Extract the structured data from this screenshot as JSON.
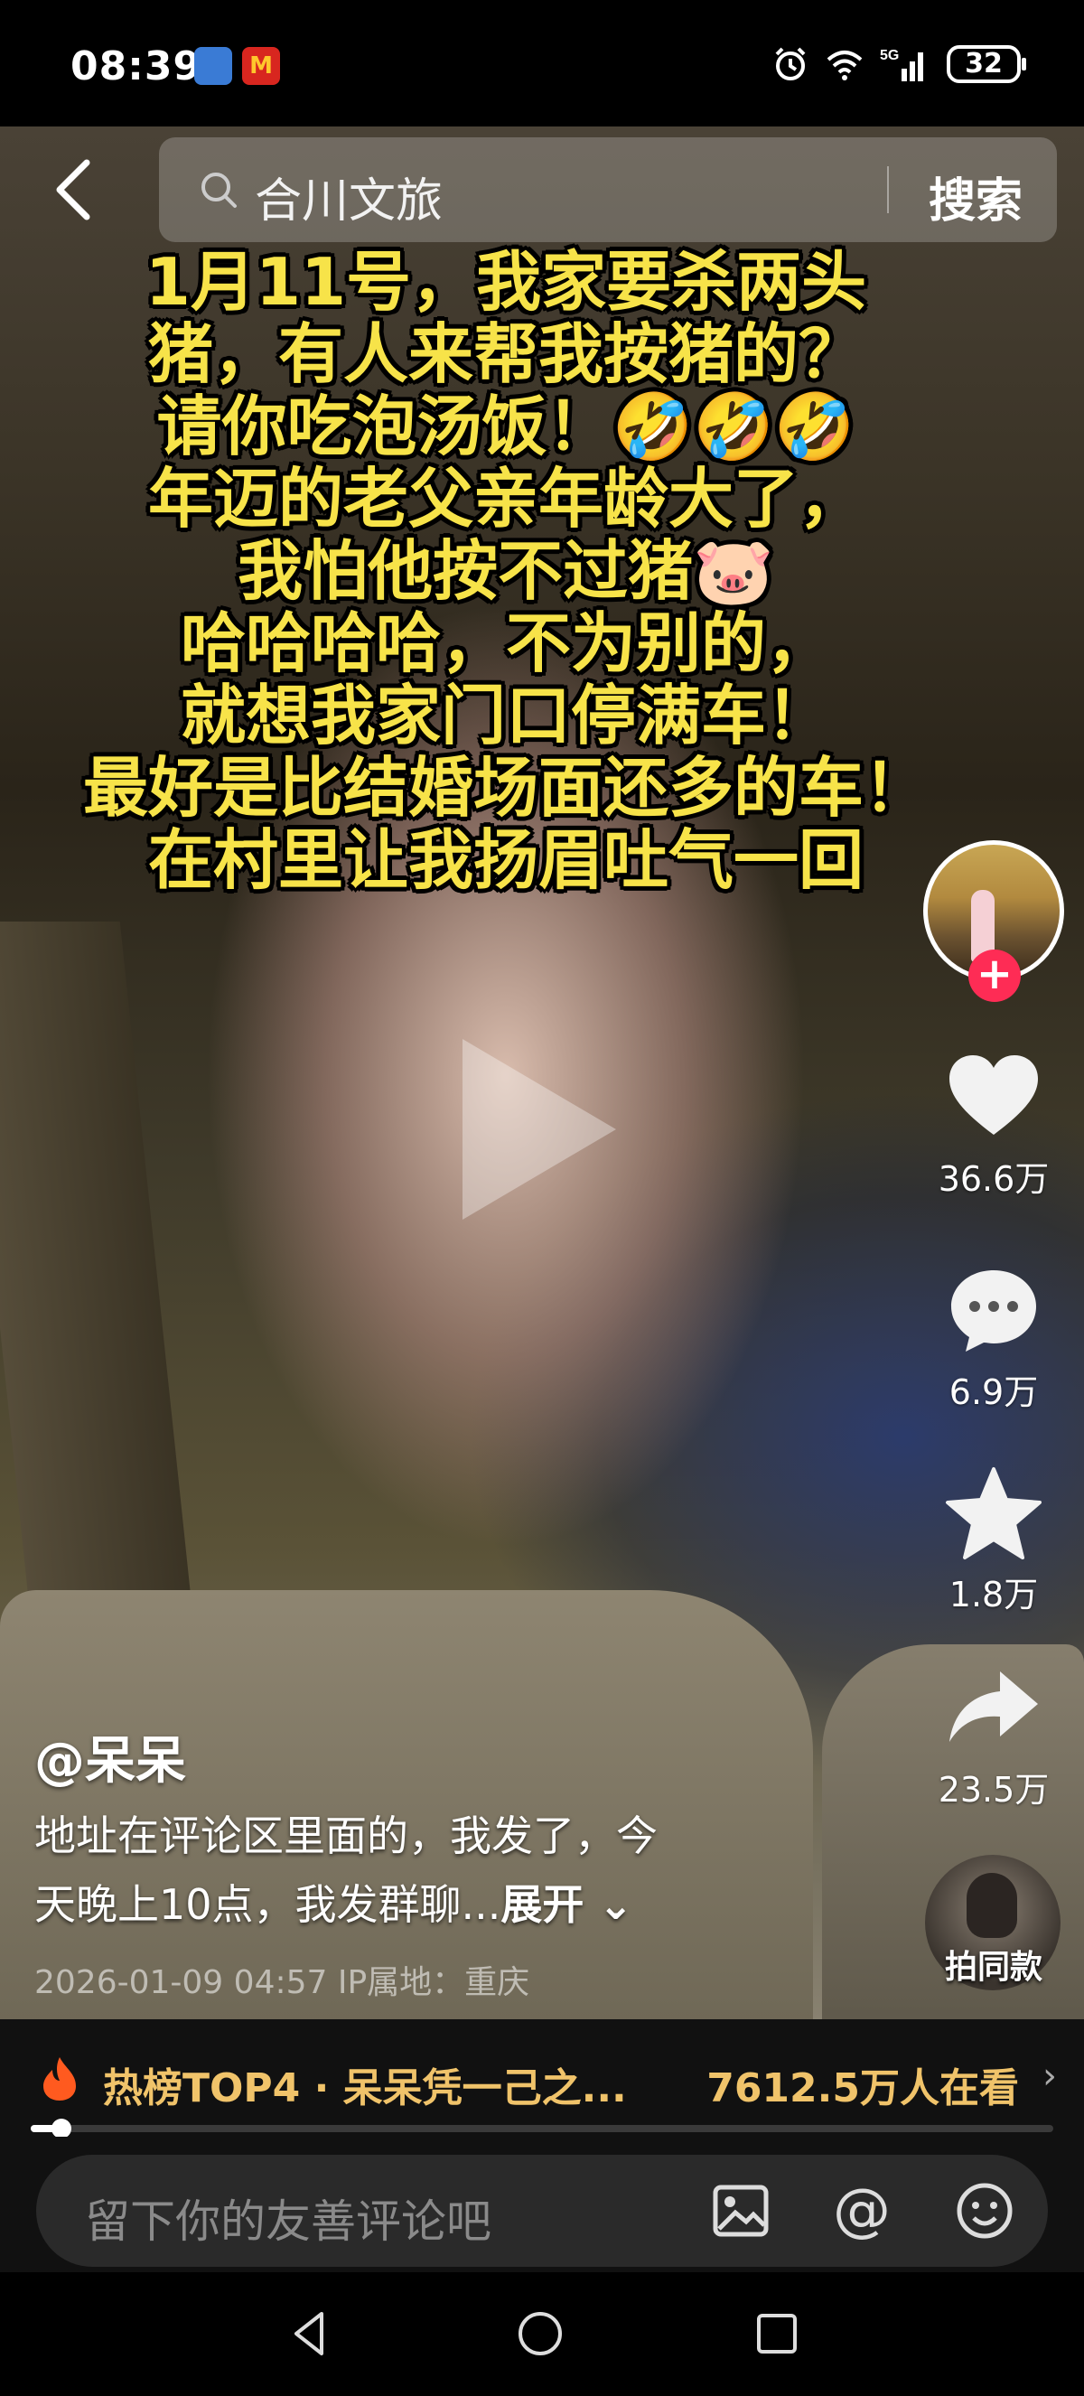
{
  "status_bar": {
    "time": "08:39",
    "network": "5G",
    "battery": "32",
    "badges": [
      "App Market",
      "M"
    ]
  },
  "search": {
    "query": "合川文旅",
    "button_label": "搜索"
  },
  "caption_lines": [
    "1月11号，我家要杀两头",
    "猪，有人来帮我按猪的？",
    "请你吃泡汤饭！🤣🤣🤣",
    "年迈的老父亲年龄大了，",
    "我怕他按不过猪🐷",
    "哈哈哈哈，不为别的，",
    "就想我家门口停满车！",
    "最好是比结婚场面还多的车！",
    "在村里让我扬眉吐气一回"
  ],
  "actions": {
    "likes": "36.6万",
    "comments": "6.9万",
    "favorites": "1.8万",
    "shares": "23.5万"
  },
  "same_style_label": "拍同款",
  "post": {
    "author": "@呆呆",
    "description_line1": "地址在评论区里面的，我发了，今",
    "description_line2": "天晚上10点，我发群聊...",
    "expand_label": "展开",
    "meta": "2026-01-09 04:57  IP属地：重庆"
  },
  "hot": {
    "title": "热榜TOP4 · 呆呆凭一己之...",
    "viewers": "7612.5万人在看"
  },
  "progress": {
    "fraction": 0.03
  },
  "comment": {
    "placeholder": "留下你的友善评论吧",
    "at_symbol": "@"
  },
  "colors": {
    "caption_yellow": "#f7e349",
    "follow_red": "#fe2c55",
    "hot_gold": "#f0c36a"
  }
}
